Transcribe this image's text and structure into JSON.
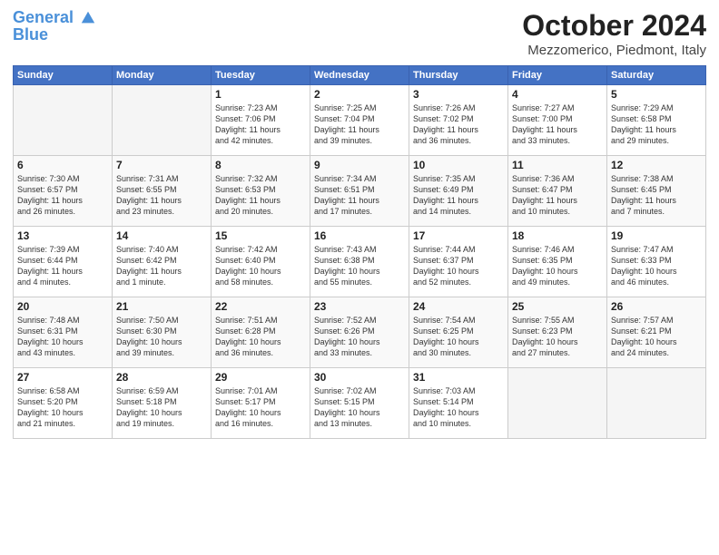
{
  "logo": {
    "line1": "General",
    "line2": "Blue"
  },
  "title": "October 2024",
  "location": "Mezzomerico, Piedmont, Italy",
  "headers": [
    "Sunday",
    "Monday",
    "Tuesday",
    "Wednesday",
    "Thursday",
    "Friday",
    "Saturday"
  ],
  "weeks": [
    [
      {
        "num": "",
        "lines": []
      },
      {
        "num": "",
        "lines": []
      },
      {
        "num": "1",
        "lines": [
          "Sunrise: 7:23 AM",
          "Sunset: 7:06 PM",
          "Daylight: 11 hours",
          "and 42 minutes."
        ]
      },
      {
        "num": "2",
        "lines": [
          "Sunrise: 7:25 AM",
          "Sunset: 7:04 PM",
          "Daylight: 11 hours",
          "and 39 minutes."
        ]
      },
      {
        "num": "3",
        "lines": [
          "Sunrise: 7:26 AM",
          "Sunset: 7:02 PM",
          "Daylight: 11 hours",
          "and 36 minutes."
        ]
      },
      {
        "num": "4",
        "lines": [
          "Sunrise: 7:27 AM",
          "Sunset: 7:00 PM",
          "Daylight: 11 hours",
          "and 33 minutes."
        ]
      },
      {
        "num": "5",
        "lines": [
          "Sunrise: 7:29 AM",
          "Sunset: 6:58 PM",
          "Daylight: 11 hours",
          "and 29 minutes."
        ]
      }
    ],
    [
      {
        "num": "6",
        "lines": [
          "Sunrise: 7:30 AM",
          "Sunset: 6:57 PM",
          "Daylight: 11 hours",
          "and 26 minutes."
        ]
      },
      {
        "num": "7",
        "lines": [
          "Sunrise: 7:31 AM",
          "Sunset: 6:55 PM",
          "Daylight: 11 hours",
          "and 23 minutes."
        ]
      },
      {
        "num": "8",
        "lines": [
          "Sunrise: 7:32 AM",
          "Sunset: 6:53 PM",
          "Daylight: 11 hours",
          "and 20 minutes."
        ]
      },
      {
        "num": "9",
        "lines": [
          "Sunrise: 7:34 AM",
          "Sunset: 6:51 PM",
          "Daylight: 11 hours",
          "and 17 minutes."
        ]
      },
      {
        "num": "10",
        "lines": [
          "Sunrise: 7:35 AM",
          "Sunset: 6:49 PM",
          "Daylight: 11 hours",
          "and 14 minutes."
        ]
      },
      {
        "num": "11",
        "lines": [
          "Sunrise: 7:36 AM",
          "Sunset: 6:47 PM",
          "Daylight: 11 hours",
          "and 10 minutes."
        ]
      },
      {
        "num": "12",
        "lines": [
          "Sunrise: 7:38 AM",
          "Sunset: 6:45 PM",
          "Daylight: 11 hours",
          "and 7 minutes."
        ]
      }
    ],
    [
      {
        "num": "13",
        "lines": [
          "Sunrise: 7:39 AM",
          "Sunset: 6:44 PM",
          "Daylight: 11 hours",
          "and 4 minutes."
        ]
      },
      {
        "num": "14",
        "lines": [
          "Sunrise: 7:40 AM",
          "Sunset: 6:42 PM",
          "Daylight: 11 hours",
          "and 1 minute."
        ]
      },
      {
        "num": "15",
        "lines": [
          "Sunrise: 7:42 AM",
          "Sunset: 6:40 PM",
          "Daylight: 10 hours",
          "and 58 minutes."
        ]
      },
      {
        "num": "16",
        "lines": [
          "Sunrise: 7:43 AM",
          "Sunset: 6:38 PM",
          "Daylight: 10 hours",
          "and 55 minutes."
        ]
      },
      {
        "num": "17",
        "lines": [
          "Sunrise: 7:44 AM",
          "Sunset: 6:37 PM",
          "Daylight: 10 hours",
          "and 52 minutes."
        ]
      },
      {
        "num": "18",
        "lines": [
          "Sunrise: 7:46 AM",
          "Sunset: 6:35 PM",
          "Daylight: 10 hours",
          "and 49 minutes."
        ]
      },
      {
        "num": "19",
        "lines": [
          "Sunrise: 7:47 AM",
          "Sunset: 6:33 PM",
          "Daylight: 10 hours",
          "and 46 minutes."
        ]
      }
    ],
    [
      {
        "num": "20",
        "lines": [
          "Sunrise: 7:48 AM",
          "Sunset: 6:31 PM",
          "Daylight: 10 hours",
          "and 43 minutes."
        ]
      },
      {
        "num": "21",
        "lines": [
          "Sunrise: 7:50 AM",
          "Sunset: 6:30 PM",
          "Daylight: 10 hours",
          "and 39 minutes."
        ]
      },
      {
        "num": "22",
        "lines": [
          "Sunrise: 7:51 AM",
          "Sunset: 6:28 PM",
          "Daylight: 10 hours",
          "and 36 minutes."
        ]
      },
      {
        "num": "23",
        "lines": [
          "Sunrise: 7:52 AM",
          "Sunset: 6:26 PM",
          "Daylight: 10 hours",
          "and 33 minutes."
        ]
      },
      {
        "num": "24",
        "lines": [
          "Sunrise: 7:54 AM",
          "Sunset: 6:25 PM",
          "Daylight: 10 hours",
          "and 30 minutes."
        ]
      },
      {
        "num": "25",
        "lines": [
          "Sunrise: 7:55 AM",
          "Sunset: 6:23 PM",
          "Daylight: 10 hours",
          "and 27 minutes."
        ]
      },
      {
        "num": "26",
        "lines": [
          "Sunrise: 7:57 AM",
          "Sunset: 6:21 PM",
          "Daylight: 10 hours",
          "and 24 minutes."
        ]
      }
    ],
    [
      {
        "num": "27",
        "lines": [
          "Sunrise: 6:58 AM",
          "Sunset: 5:20 PM",
          "Daylight: 10 hours",
          "and 21 minutes."
        ]
      },
      {
        "num": "28",
        "lines": [
          "Sunrise: 6:59 AM",
          "Sunset: 5:18 PM",
          "Daylight: 10 hours",
          "and 19 minutes."
        ]
      },
      {
        "num": "29",
        "lines": [
          "Sunrise: 7:01 AM",
          "Sunset: 5:17 PM",
          "Daylight: 10 hours",
          "and 16 minutes."
        ]
      },
      {
        "num": "30",
        "lines": [
          "Sunrise: 7:02 AM",
          "Sunset: 5:15 PM",
          "Daylight: 10 hours",
          "and 13 minutes."
        ]
      },
      {
        "num": "31",
        "lines": [
          "Sunrise: 7:03 AM",
          "Sunset: 5:14 PM",
          "Daylight: 10 hours",
          "and 10 minutes."
        ]
      },
      {
        "num": "",
        "lines": []
      },
      {
        "num": "",
        "lines": []
      }
    ]
  ]
}
